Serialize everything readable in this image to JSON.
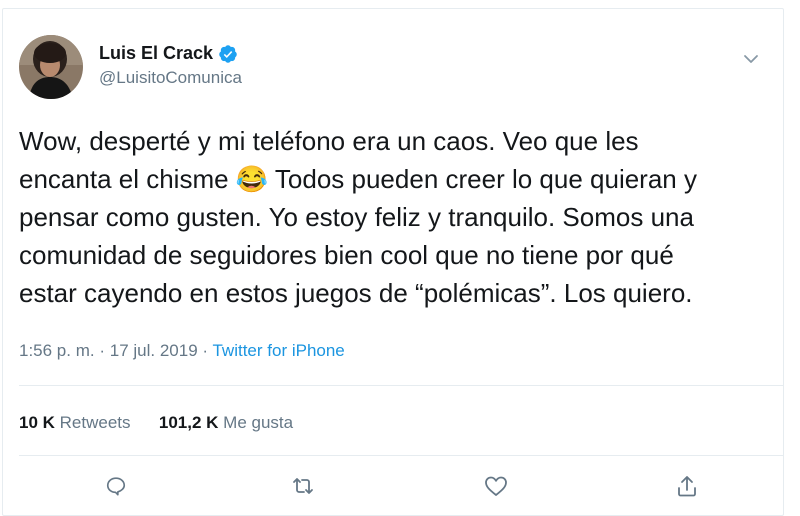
{
  "user": {
    "name": "Luis El Crack",
    "handle": "@LuisitoComunica",
    "verified": true
  },
  "tweet": {
    "text": "Wow, desperté y mi teléfono era un caos. Veo que les\nencanta el chisme 😂 Todos pueden creer lo que quieran y\npensar como gusten. Yo estoy feliz y tranquilo. Somos una\ncomunidad de seguidores bien cool que no tiene por qué\nestar cayendo en estos juegos de “polémicas”. Los quiero.",
    "time": "1:56 p. m.",
    "date": "17 jul. 2019",
    "separator": "·",
    "source": "Twitter for iPhone"
  },
  "stats": {
    "retweets_count": "10 K",
    "retweets_label": "Retweets",
    "likes_count": "101,2 K",
    "likes_label": "Me gusta"
  },
  "icons": {
    "verified": "verified-badge-icon",
    "caret": "chevron-down-icon",
    "reply": "reply-icon",
    "retweet": "retweet-icon",
    "like": "heart-icon",
    "share": "share-icon"
  },
  "colors": {
    "verified_blue": "#1da1f2",
    "link_blue": "#1b95e0",
    "secondary_text": "#657786",
    "primary_text": "#14171a",
    "border": "#e6ecf0"
  }
}
